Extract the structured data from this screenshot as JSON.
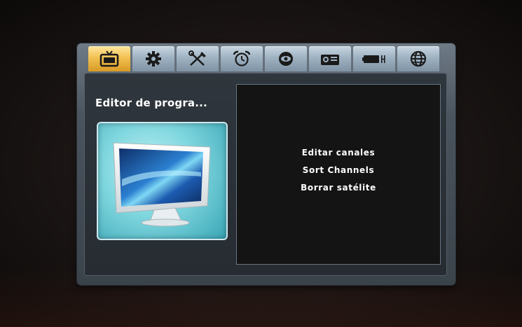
{
  "menu": {
    "tabs": [
      {
        "icon": "tv-icon",
        "active": true
      },
      {
        "icon": "gear-icon",
        "active": false
      },
      {
        "icon": "tools-icon",
        "active": false
      },
      {
        "icon": "alarm-clock-icon",
        "active": false
      },
      {
        "icon": "eye-icon",
        "active": false
      },
      {
        "icon": "projector-icon",
        "active": false
      },
      {
        "icon": "battery-icon",
        "active": false
      },
      {
        "icon": "globe-icon",
        "active": false
      }
    ],
    "title": "Editor de progra...",
    "preview_icon": "tv-screen-illustration",
    "items": [
      "Editar canales",
      "Sort Channels",
      "Borrar satélite"
    ]
  },
  "colors": {
    "active_tab": "#f2c152",
    "inactive_tab": "#9fb2c2",
    "panel_bg": "#2a3037",
    "list_bg": "#141414",
    "preview_bg": "#7fd6de",
    "text": "#ffffff"
  }
}
